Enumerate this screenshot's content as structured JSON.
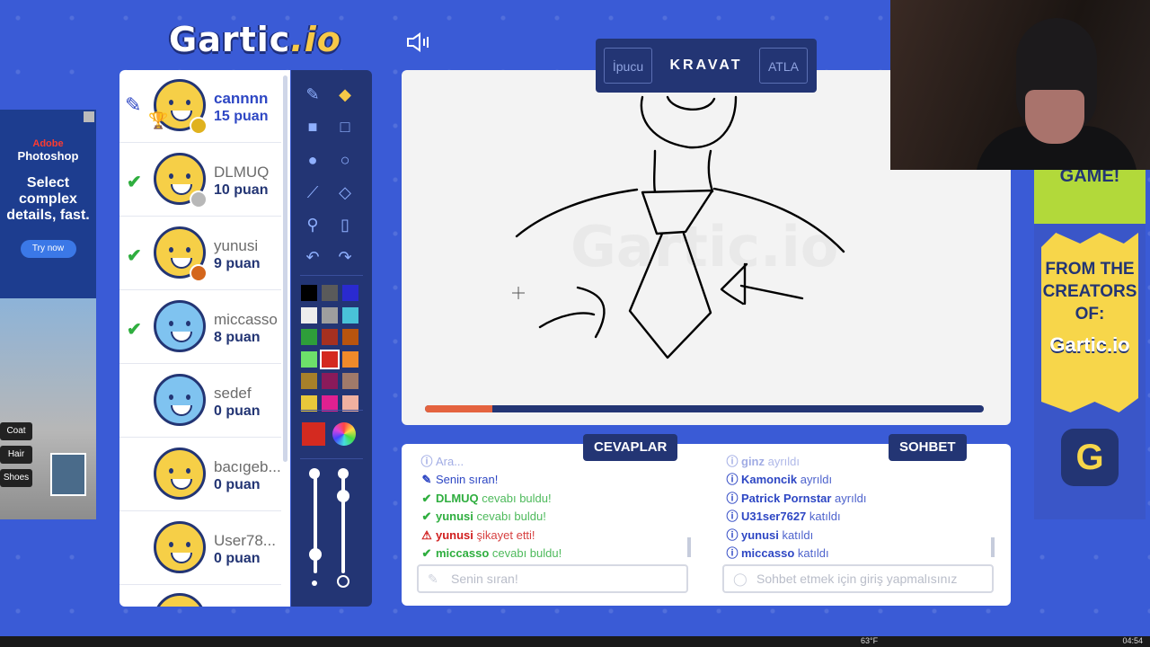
{
  "app": {
    "logo_main": "Gartic",
    "logo_suffix": ".io"
  },
  "word_bar": {
    "hint_label": "İpucu",
    "word": "KRAVAT",
    "skip_label": "ATLA"
  },
  "round": {
    "progress_percent": 12
  },
  "players": [
    {
      "name": "cannnn",
      "score": "15 puan",
      "status": "drawing",
      "badge_color": "#e0b21e",
      "is_me": true
    },
    {
      "name": "DLMUQ",
      "score": "10 puan",
      "status": "guessed",
      "badge_color": "#b8b8b8",
      "is_me": false
    },
    {
      "name": "yunusi",
      "score": "9 puan",
      "status": "guessed",
      "badge_color": "#d4661c",
      "is_me": false
    },
    {
      "name": "miccasso",
      "score": "8 puan",
      "status": "guessed",
      "badge_color": "",
      "is_me": false
    },
    {
      "name": "sedef",
      "score": "0 puan",
      "status": "",
      "badge_color": "",
      "is_me": false
    },
    {
      "name": "bacıgeb...",
      "score": "0 puan",
      "status": "",
      "badge_color": "",
      "is_me": false
    },
    {
      "name": "User78...",
      "score": "0 puan",
      "status": "",
      "badge_color": "",
      "is_me": false
    }
  ],
  "palette": [
    "#000000",
    "#5a5a5a",
    "#2a2ad0",
    "#ededed",
    "#9e9e9e",
    "#49c2d8",
    "#2e9e3a",
    "#a63020",
    "#b8540e",
    "#6de06a",
    "#d42a20",
    "#f08a2a",
    "#a8802a",
    "#8a1a5a",
    "#a07a6a",
    "#e8c83a",
    "#e02090",
    "#f0b0a0"
  ],
  "selected_color": "#d42a20",
  "answers": {
    "title": "CEVAPLAR",
    "messages": [
      {
        "icon": "info",
        "name": "",
        "text": "Ara...",
        "faded": true
      },
      {
        "icon": "pencil",
        "name": "",
        "text": "Senin sıran!"
      },
      {
        "icon": "check",
        "name": "DLMUQ",
        "text": " cevabı buldu!"
      },
      {
        "icon": "check",
        "name": "yunusi",
        "text": " cevabı buldu!"
      },
      {
        "icon": "warning",
        "name": "yunusi",
        "text": " şikayet etti!"
      },
      {
        "icon": "check",
        "name": "miccasso",
        "text": " cevabı buldu!"
      }
    ],
    "placeholder": "Senin sıran!"
  },
  "chat": {
    "title": "SOHBET",
    "messages": [
      {
        "name": "ginz",
        "text": " ayrıldı",
        "faded": true
      },
      {
        "name": "Kamoncik",
        "text": " ayrıldı"
      },
      {
        "name": "Patrick Pornstar",
        "text": " ayrıldı"
      },
      {
        "name": "U31ser7627",
        "text": " katıldı"
      },
      {
        "name": "yunusi",
        "text": " katıldı"
      },
      {
        "name": "miccasso",
        "text": " katıldı"
      }
    ],
    "placeholder": "Sohbet etmek için giriş yapmalısınız"
  },
  "ad_left": {
    "brand_small": "Adobe",
    "brand": "Photoshop",
    "headline": "Select complex details, fast.",
    "cta": "Try now",
    "chips": [
      "Coat",
      "Hair",
      "Shoes"
    ]
  },
  "ad_right": {
    "top": "GAME!",
    "body": "FROM THE CREATORS OF:",
    "logo": "Gartic.io",
    "button": "G"
  },
  "taskbar": {
    "temp": "63°F",
    "time": "04:54"
  }
}
